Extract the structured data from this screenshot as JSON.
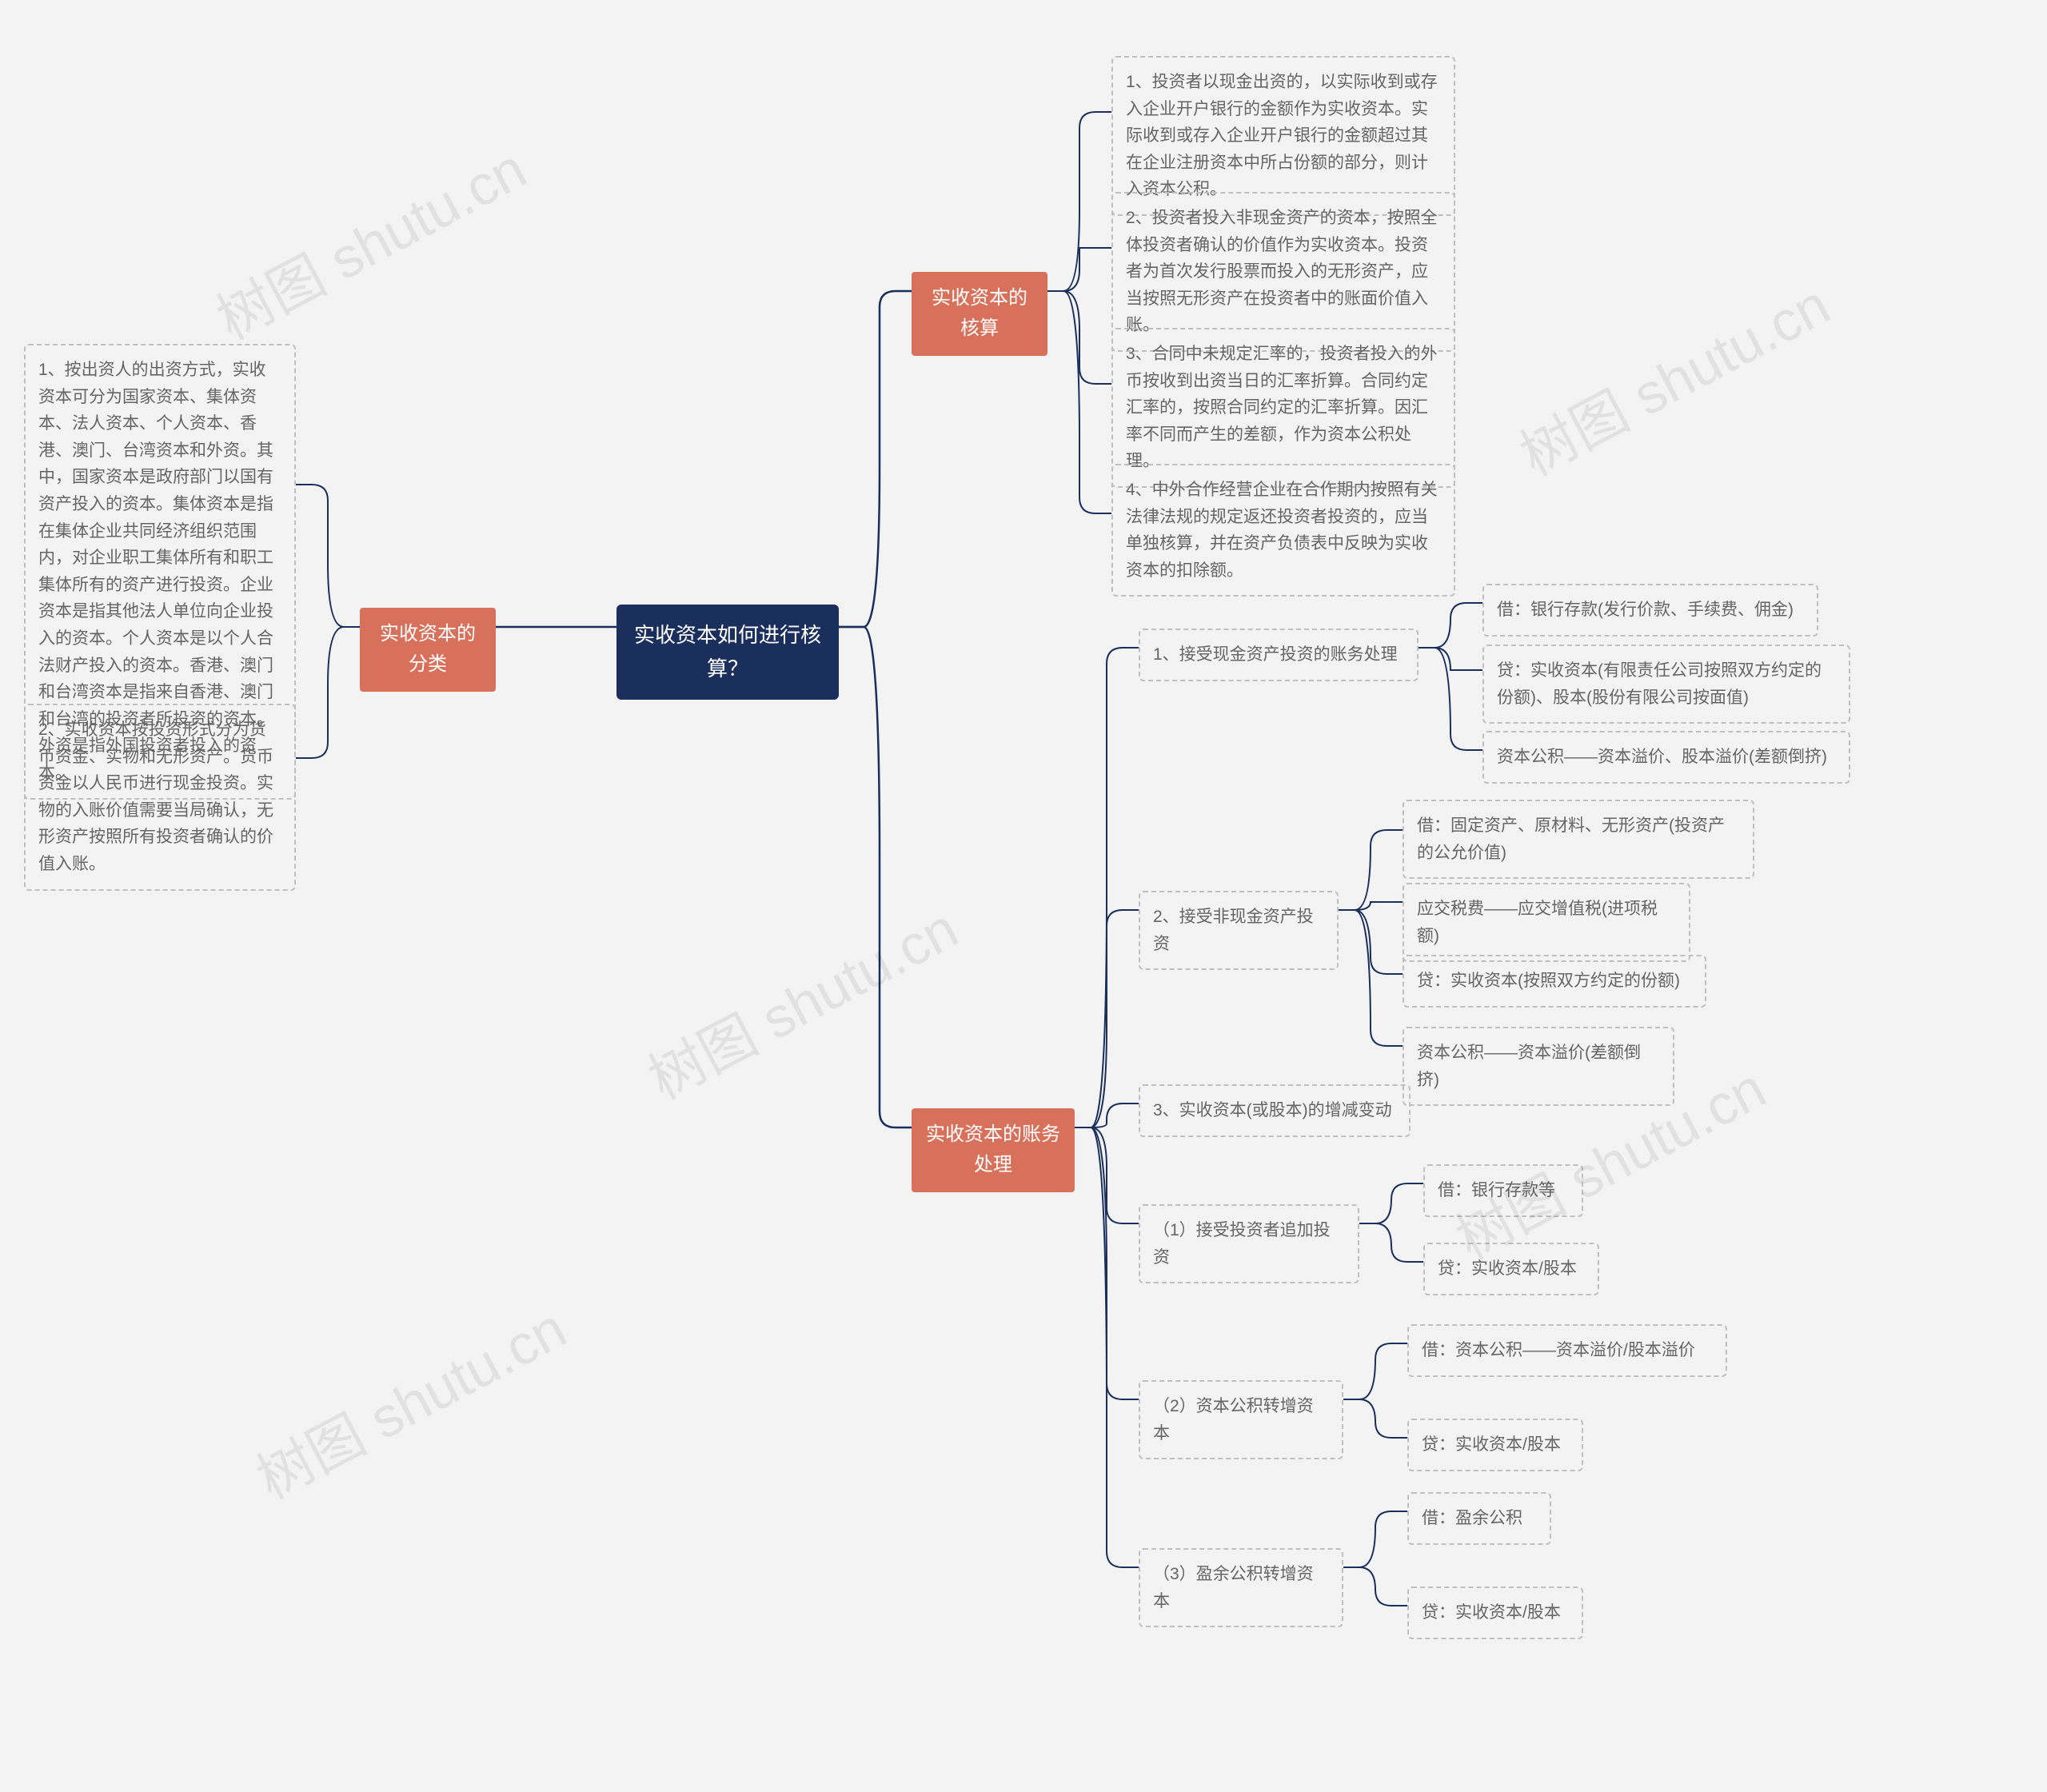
{
  "root": {
    "title": "实收资本如何进行核算？"
  },
  "left": {
    "branch_label": "实收资本的分类",
    "items": [
      "1、按出资人的出资方式，实收资本可分为国家资本、集体资本、法人资本、个人资本、香港、澳门、台湾资本和外资。其中，国家资本是政府部门以国有资产投入的资本。集体资本是指在集体企业共同经济组织范围内，对企业职工集体所有和职工集体所有的资产进行投资。企业资本是指其他法人单位向企业投入的资本。个人资本是以个人合法财产投入的资本。香港、澳门和台湾资本是指来自香港、澳门和台湾的投资者所投资的资本。外资是指外国投资者投入的资本。",
      "2、实收资本按投资形式分为货币资金、实物和无形资产。货币资金以人民币进行现金投资。实物的入账价值需要当局确认，无形资产按照所有投资者确认的价值入账。"
    ]
  },
  "right1": {
    "branch_label": "实收资本的核算",
    "items": [
      "1、投资者以现金出资的，以实际收到或存入企业开户银行的金额作为实收资本。实际收到或存入企业开户银行的金额超过其在企业注册资本中所占份额的部分，则计入资本公积。",
      "2、投资者投入非现金资产的资本，按照全体投资者确认的价值作为实收资本。投资者为首次发行股票而投入的无形资产，应当按照无形资产在投资者中的账面价值入账。",
      "3、合同中未规定汇率的，投资者投入的外币按收到出资当日的汇率折算。合同约定汇率的，按照合同约定的汇率折算。因汇率不同而产生的差额，作为资本公积处理。",
      "4、中外合作经营企业在合作期内按照有关法律法规的规定返还投资者投资的，应当单独核算，并在资产负债表中反映为实收资本的扣除额。"
    ]
  },
  "right2": {
    "branch_label": "实收资本的账务处理",
    "items": {
      "a1": {
        "label": "1、接受现金资产投资的账务处理",
        "subs": [
          "借：银行存款(发行价款、手续费、佣金)",
          "贷：实收资本(有限责任公司按照双方约定的份额)、股本(股份有限公司按面值)",
          "资本公积——资本溢价、股本溢价(差额倒挤)"
        ]
      },
      "a2": {
        "label": "2、接受非现金资产投资",
        "subs": [
          "借：固定资产、原材料、无形资产(投资产的公允价值)",
          "应交税费——应交增值税(进项税额)",
          "贷：实收资本(按照双方约定的份额)",
          "资本公积——资本溢价(差额倒挤)"
        ]
      },
      "a3": {
        "label": "3、实收资本(或股本)的增减变动"
      },
      "a4": {
        "label": "（1）接受投资者追加投资",
        "subs": [
          "借：银行存款等",
          "贷：实收资本/股本"
        ]
      },
      "a5": {
        "label": "（2）资本公积转增资本",
        "subs": [
          "借：资本公积——资本溢价/股本溢价",
          "贷：实收资本/股本"
        ]
      },
      "a6": {
        "label": "（3）盈余公积转增资本",
        "subs": [
          "借：盈余公积",
          "贷：实收资本/股本"
        ]
      }
    }
  },
  "watermark": "树图 shutu.cn"
}
